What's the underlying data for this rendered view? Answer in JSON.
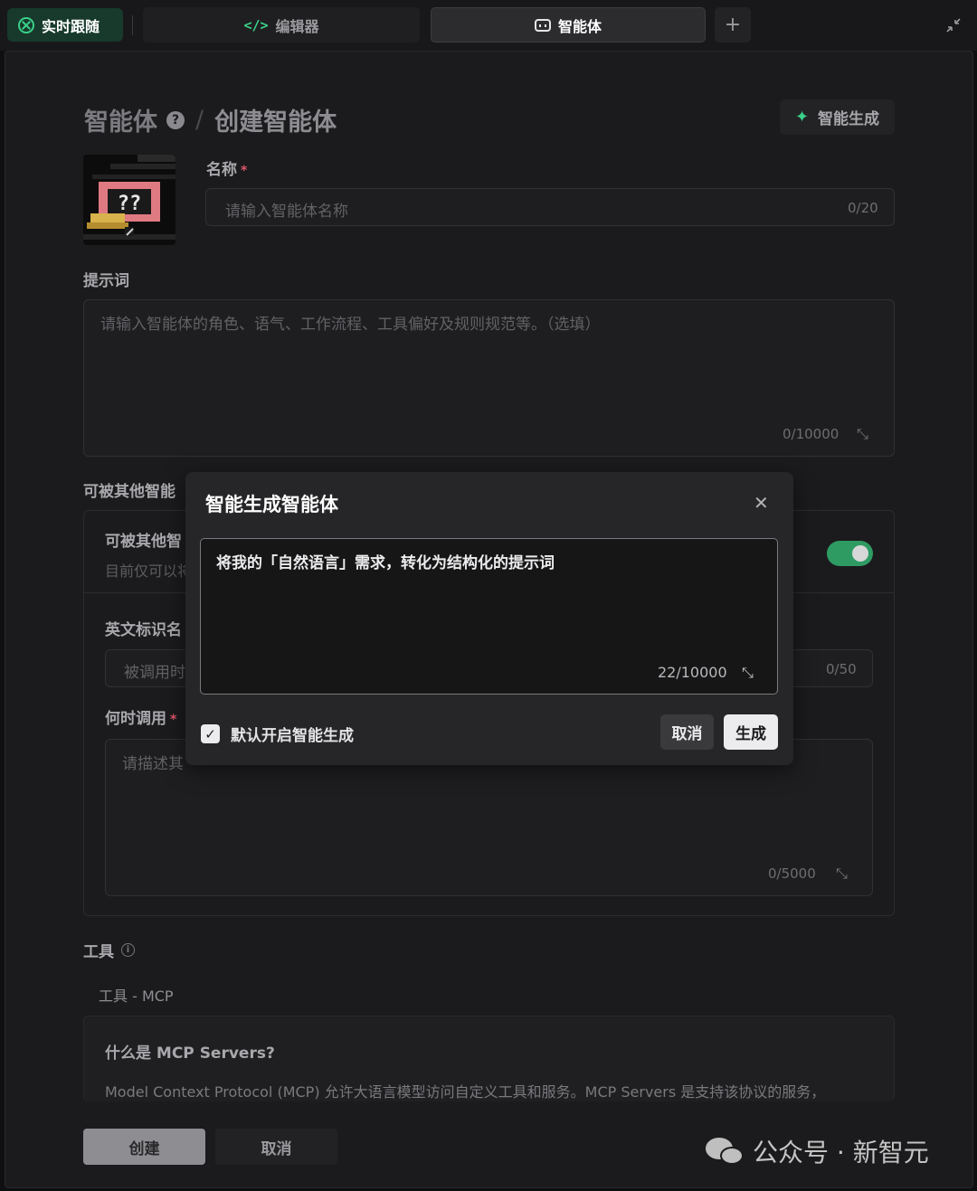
{
  "tabs": {
    "live": "实时跟随",
    "editor": "编辑器",
    "agent": "智能体",
    "add": "+"
  },
  "header": {
    "breadcrumb_parent": "智能体",
    "breadcrumb_current": "创建智能体",
    "help": "?",
    "ai_generate": "智能生成"
  },
  "avatar_glyph": "??",
  "name": {
    "label": "名称",
    "required": "*",
    "placeholder": "请输入智能体名称",
    "counter": "0/20"
  },
  "prompt": {
    "label": "提示词",
    "placeholder": "请输入智能体的角色、语气、工作流程、工具偏好及规则规范等。（选填）",
    "counter": "0/10000"
  },
  "callable": {
    "section_label": "可被其他智能",
    "row_title": "可被其他智",
    "row_desc": "目前仅可以将",
    "toggle_on": true
  },
  "english_name": {
    "label": "英文标识名",
    "placeholder": "被调用时",
    "counter": "0/50"
  },
  "when_to_call": {
    "label": "何时调用",
    "required": "*",
    "placeholder": "请描述其",
    "counter": "0/5000"
  },
  "tools": {
    "label": "工具",
    "sub_label": "工具 - MCP",
    "mcp_title": "什么是 MCP Servers?",
    "mcp_desc": "Model Context Protocol (MCP) 允许大语言模型访问自定义工具和服务。MCP Servers 是支持该协议的服务，"
  },
  "footer": {
    "create": "创建",
    "cancel": "取消"
  },
  "watermark": "公众号 · 新智元",
  "modal": {
    "title": "智能生成智能体",
    "input_value": "将我的「自然语言」需求，转化为结构化的提示词",
    "counter": "22/10000",
    "checkbox_label": "默认开启智能生成",
    "checkbox_checked": true,
    "cancel": "取消",
    "confirm": "生成"
  },
  "colors": {
    "accent_green": "#3ad18a",
    "toggle_green": "#2e9b63",
    "required_red": "#e0566a"
  }
}
